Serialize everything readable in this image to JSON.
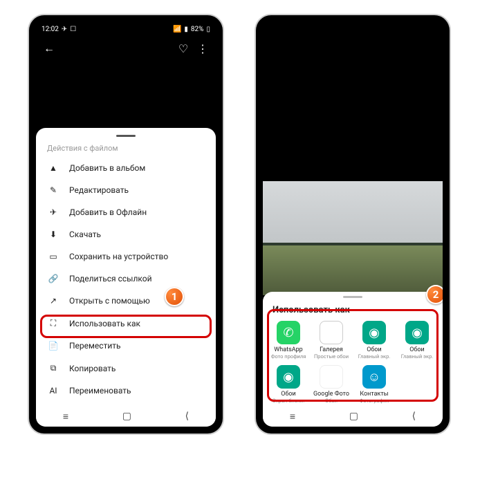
{
  "status": {
    "time": "12:02",
    "battery": "82%"
  },
  "sheet_left": {
    "title": "Действия с файлом",
    "items": [
      {
        "icon": "image-plus-icon",
        "glyph": "▲",
        "label": "Добавить в альбом"
      },
      {
        "icon": "pencil-icon",
        "glyph": "✎",
        "label": "Редактировать"
      },
      {
        "icon": "airplane-icon",
        "glyph": "✈",
        "label": "Добавить в Офлайн"
      },
      {
        "icon": "download-icon",
        "glyph": "⬇",
        "label": "Скачать"
      },
      {
        "icon": "device-icon",
        "glyph": "▭",
        "label": "Сохранить на устройство"
      },
      {
        "icon": "link-icon",
        "glyph": "🔗",
        "label": "Поделиться ссылкой"
      },
      {
        "icon": "open-with-icon",
        "glyph": "↗",
        "label": "Открыть с помощью"
      },
      {
        "icon": "use-as-icon",
        "glyph": "⛶",
        "label": "Использовать как"
      },
      {
        "icon": "move-icon",
        "glyph": "📄",
        "label": "Переместить"
      },
      {
        "icon": "copy-icon",
        "glyph": "⧉",
        "label": "Копировать"
      },
      {
        "icon": "rename-icon",
        "glyph": "AI",
        "label": "Переименовать"
      }
    ]
  },
  "sheet_right": {
    "title": "Использовать как",
    "apps": [
      {
        "name": "whatsapp",
        "label": "WhatsApp",
        "sub": "Фото профиля",
        "cls": "wa",
        "glyph": "✆"
      },
      {
        "name": "gallery",
        "label": "Галерея",
        "sub": "Простые обои",
        "cls": "gal",
        "glyph": "🖼"
      },
      {
        "name": "wallpaper-1",
        "label": "Обои",
        "sub": "Главный экр.",
        "cls": "teal",
        "glyph": "◉"
      },
      {
        "name": "wallpaper-2",
        "label": "Обои",
        "sub": "Главный экр.",
        "cls": "teal",
        "glyph": "◉"
      },
      {
        "name": "wallpaper-lock",
        "label": "Обои",
        "sub": "Экран блоки.",
        "cls": "teal",
        "glyph": "◉"
      },
      {
        "name": "google-photos",
        "label": "Google Фото",
        "sub": "Обои",
        "cls": "gp",
        "glyph": "✦"
      },
      {
        "name": "contacts",
        "label": "Контакты",
        "sub": "Фотография",
        "cls": "ct",
        "glyph": "☺"
      }
    ]
  },
  "markers": {
    "one": "1",
    "two": "2"
  }
}
